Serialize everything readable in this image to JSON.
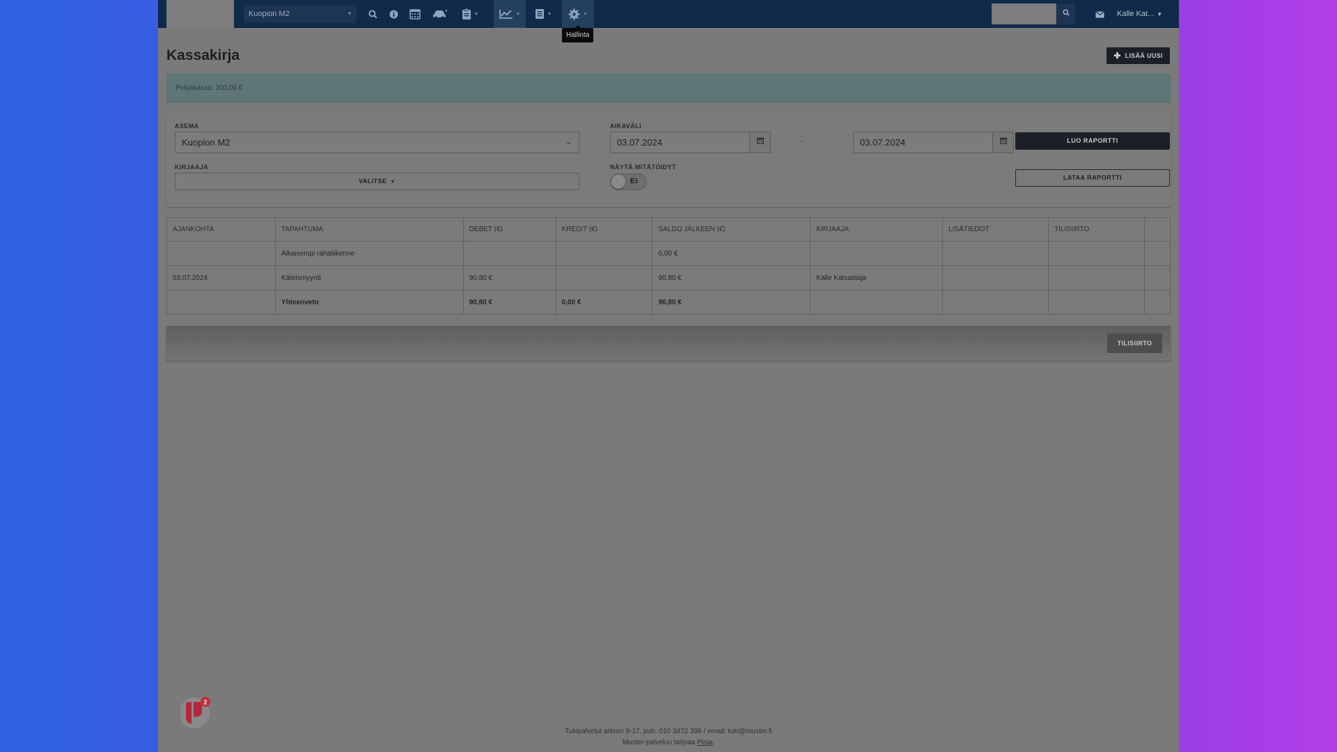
{
  "nav": {
    "station": "Kuopion M2",
    "icons": [
      "search-icon",
      "info-icon",
      "calendar-icon",
      "car-icon",
      "clipboard-icon",
      "chart-icon",
      "report-icon",
      "gear-icon"
    ],
    "tooltip": "Hallinta",
    "search_value": "",
    "user": "Kalle Kat..."
  },
  "page": {
    "title": "Kassakirja",
    "add_button": "LISÄÄ UUSI",
    "info": "Pohjakassa: 200,00 €"
  },
  "filters": {
    "asema_label": "ASEMA",
    "asema_value": "Kuopion M2",
    "aikavali_label": "AIKAVÄLI",
    "date_from": "03.07.2024",
    "dash": "-",
    "date_to": "03.07.2024",
    "kirjaaja_label": "KIRJAAJA",
    "kirjaaja_value": "VALITSE",
    "nayta_label": "NÄYTÄ MITÄTÖIDYT",
    "toggle_text": "EI",
    "luo_button": "LUO RAPORTTI",
    "lataa_button": "LATAA RAPORTTI"
  },
  "table": {
    "headers": [
      "AJANKOHTA",
      "TAPAHTUMA",
      "DEBET (€)",
      "KREDIT (€)",
      "SALDO JÄLKEEN (€)",
      "KIRJAAJA",
      "LISÄTIEDOT",
      "TILISIIRTO",
      ""
    ],
    "rows": [
      [
        "",
        "Aikaisempi rahaliikenne",
        "",
        "",
        "0,00 €",
        "",
        "",
        "",
        ""
      ],
      [
        "03.07.2024",
        "Käteismyynti",
        "90,80 €",
        "",
        "90,80 €",
        "Kalle Katsastaja",
        "",
        "",
        ""
      ]
    ],
    "summary": [
      "",
      "Yhteenveto",
      "90,80 €",
      "0,00 €",
      "90,80 €",
      "",
      "",
      "",
      ""
    ]
  },
  "bottom": {
    "tilisiirto_button": "TILISIIRTO"
  },
  "footer": {
    "line1": "Tukipalvelut arkisin 8-17, puh: 010 3472 399 / email: tuki@muster.fi",
    "line2_prefix": "Muster-palvelun tarjoaa ",
    "line2_link": "Pinja",
    "line2_suffix": "."
  },
  "chat": {
    "badge": "2"
  },
  "colors": {
    "topbar": "#0f2a4a",
    "dark_button": "#1b1f27",
    "info_bar": "#5f7677",
    "badge": "#c62d3a",
    "widget": "#b3273b"
  }
}
